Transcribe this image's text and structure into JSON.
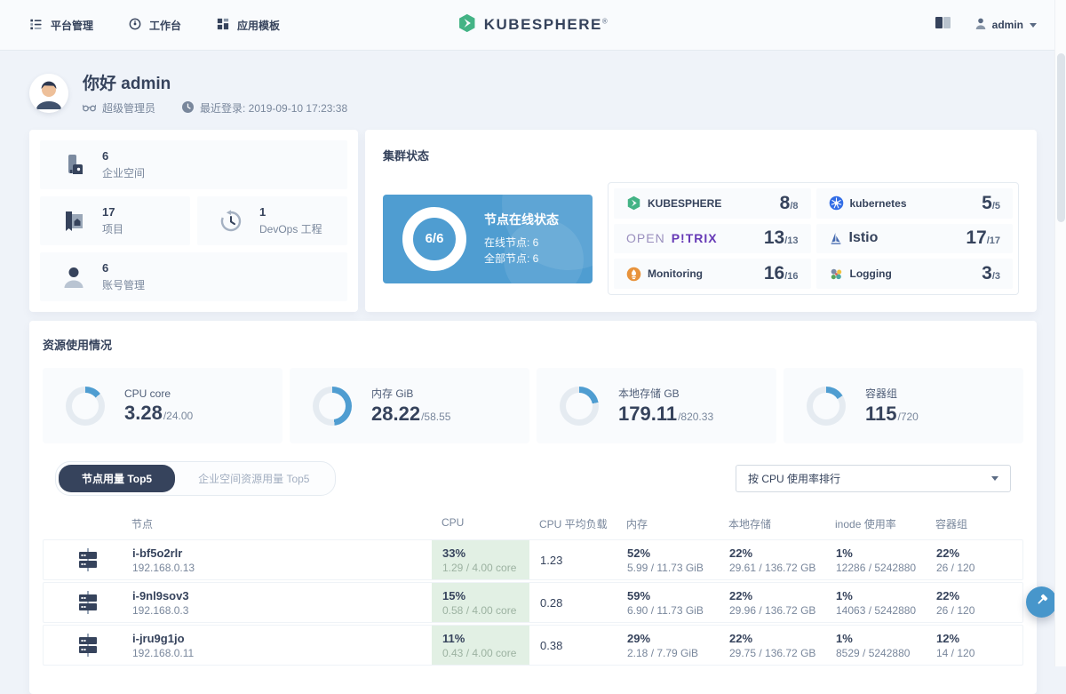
{
  "colors": {
    "accent": "#4f9dd1",
    "track": "#e5ebf1",
    "panel_blue": "#4f9dd1",
    "tab_dark": "#36435c",
    "cpu_cell_green": "#e2f0e4"
  },
  "header": {
    "nav": [
      {
        "label": "平台管理"
      },
      {
        "label": "工作台"
      },
      {
        "label": "应用模板"
      }
    ],
    "logo_text": "KUBESPHERE",
    "logo_reg": "®",
    "user": "admin"
  },
  "greeting": {
    "title": "你好 admin",
    "role": "超级管理员",
    "last_login": "最近登录: 2019-09-10 17:23:38"
  },
  "quick_stats": [
    {
      "value": "6",
      "label": "企业空间"
    },
    {
      "value": "17",
      "label": "项目"
    },
    {
      "value": "1",
      "label": "DevOps 工程"
    },
    {
      "value": "6",
      "label": "账号管理"
    }
  ],
  "cluster": {
    "title": "集群状态",
    "node_status": {
      "ratio": "6/6",
      "title": "节点在线状态",
      "online_label": "在线节点: 6",
      "total_label": "全部节点: 6"
    },
    "components": [
      {
        "name": "KUBESPHERE",
        "count": "8",
        "total": "/8"
      },
      {
        "name": "kubernetes",
        "count": "5",
        "total": "/5"
      },
      {
        "name": "OPENP!TRIX",
        "part1": "OPEN",
        "part2": "P!TRIX",
        "count": "13",
        "total": "/13"
      },
      {
        "name": "Istio",
        "count": "17",
        "total": "/17"
      },
      {
        "name": "Monitoring",
        "count": "16",
        "total": "/16"
      },
      {
        "name": "Logging",
        "count": "3",
        "total": "/3"
      }
    ]
  },
  "resources": {
    "title": "资源使用情况",
    "gauges": [
      {
        "label": "CPU core",
        "used": "3.28",
        "total": "/24.00",
        "pct": 14
      },
      {
        "label": "内存 GiB",
        "used": "28.22",
        "total": "/58.55",
        "pct": 48
      },
      {
        "label": "本地存储 GB",
        "used": "179.11",
        "total": "/820.33",
        "pct": 22
      },
      {
        "label": "容器组",
        "used": "115",
        "total": "/720",
        "pct": 16
      }
    ],
    "tabs": [
      {
        "label": "节点用量 Top5"
      },
      {
        "label": "企业空间资源用量 Top5"
      }
    ],
    "sort_select": "按 CPU 使用率排行",
    "table": {
      "columns": [
        "节点",
        "CPU",
        "CPU 平均负载",
        "内存",
        "本地存储",
        "inode 使用率",
        "容器组"
      ],
      "rows": [
        {
          "name": "i-bf5o2rlr",
          "ip": "192.168.0.13",
          "cpu_pct": "33%",
          "cpu_detail": "1.29 / 4.00 core",
          "load": "1.23",
          "mem_pct": "52%",
          "mem_detail": "5.99 / 11.73 GiB",
          "disk_pct": "22%",
          "disk_detail": "29.61 / 136.72 GB",
          "inode_pct": "1%",
          "inode_detail": "12286 / 5242880",
          "pod_pct": "22%",
          "pod_detail": "26 / 120"
        },
        {
          "name": "i-9nl9sov3",
          "ip": "192.168.0.3",
          "cpu_pct": "15%",
          "cpu_detail": "0.58 / 4.00 core",
          "load": "0.28",
          "mem_pct": "59%",
          "mem_detail": "6.90 / 11.73 GiB",
          "disk_pct": "22%",
          "disk_detail": "29.96 / 136.72 GB",
          "inode_pct": "1%",
          "inode_detail": "14063 / 5242880",
          "pod_pct": "22%",
          "pod_detail": "26 / 120"
        },
        {
          "name": "i-jru9g1jo",
          "ip": "192.168.0.11",
          "cpu_pct": "11%",
          "cpu_detail": "0.43 / 4.00 core",
          "load": "0.38",
          "mem_pct": "29%",
          "mem_detail": "2.18 / 7.79 GiB",
          "disk_pct": "22%",
          "disk_detail": "29.75 / 136.72 GB",
          "inode_pct": "1%",
          "inode_detail": "8529 / 5242880",
          "pod_pct": "12%",
          "pod_detail": "14 / 120"
        }
      ]
    }
  }
}
